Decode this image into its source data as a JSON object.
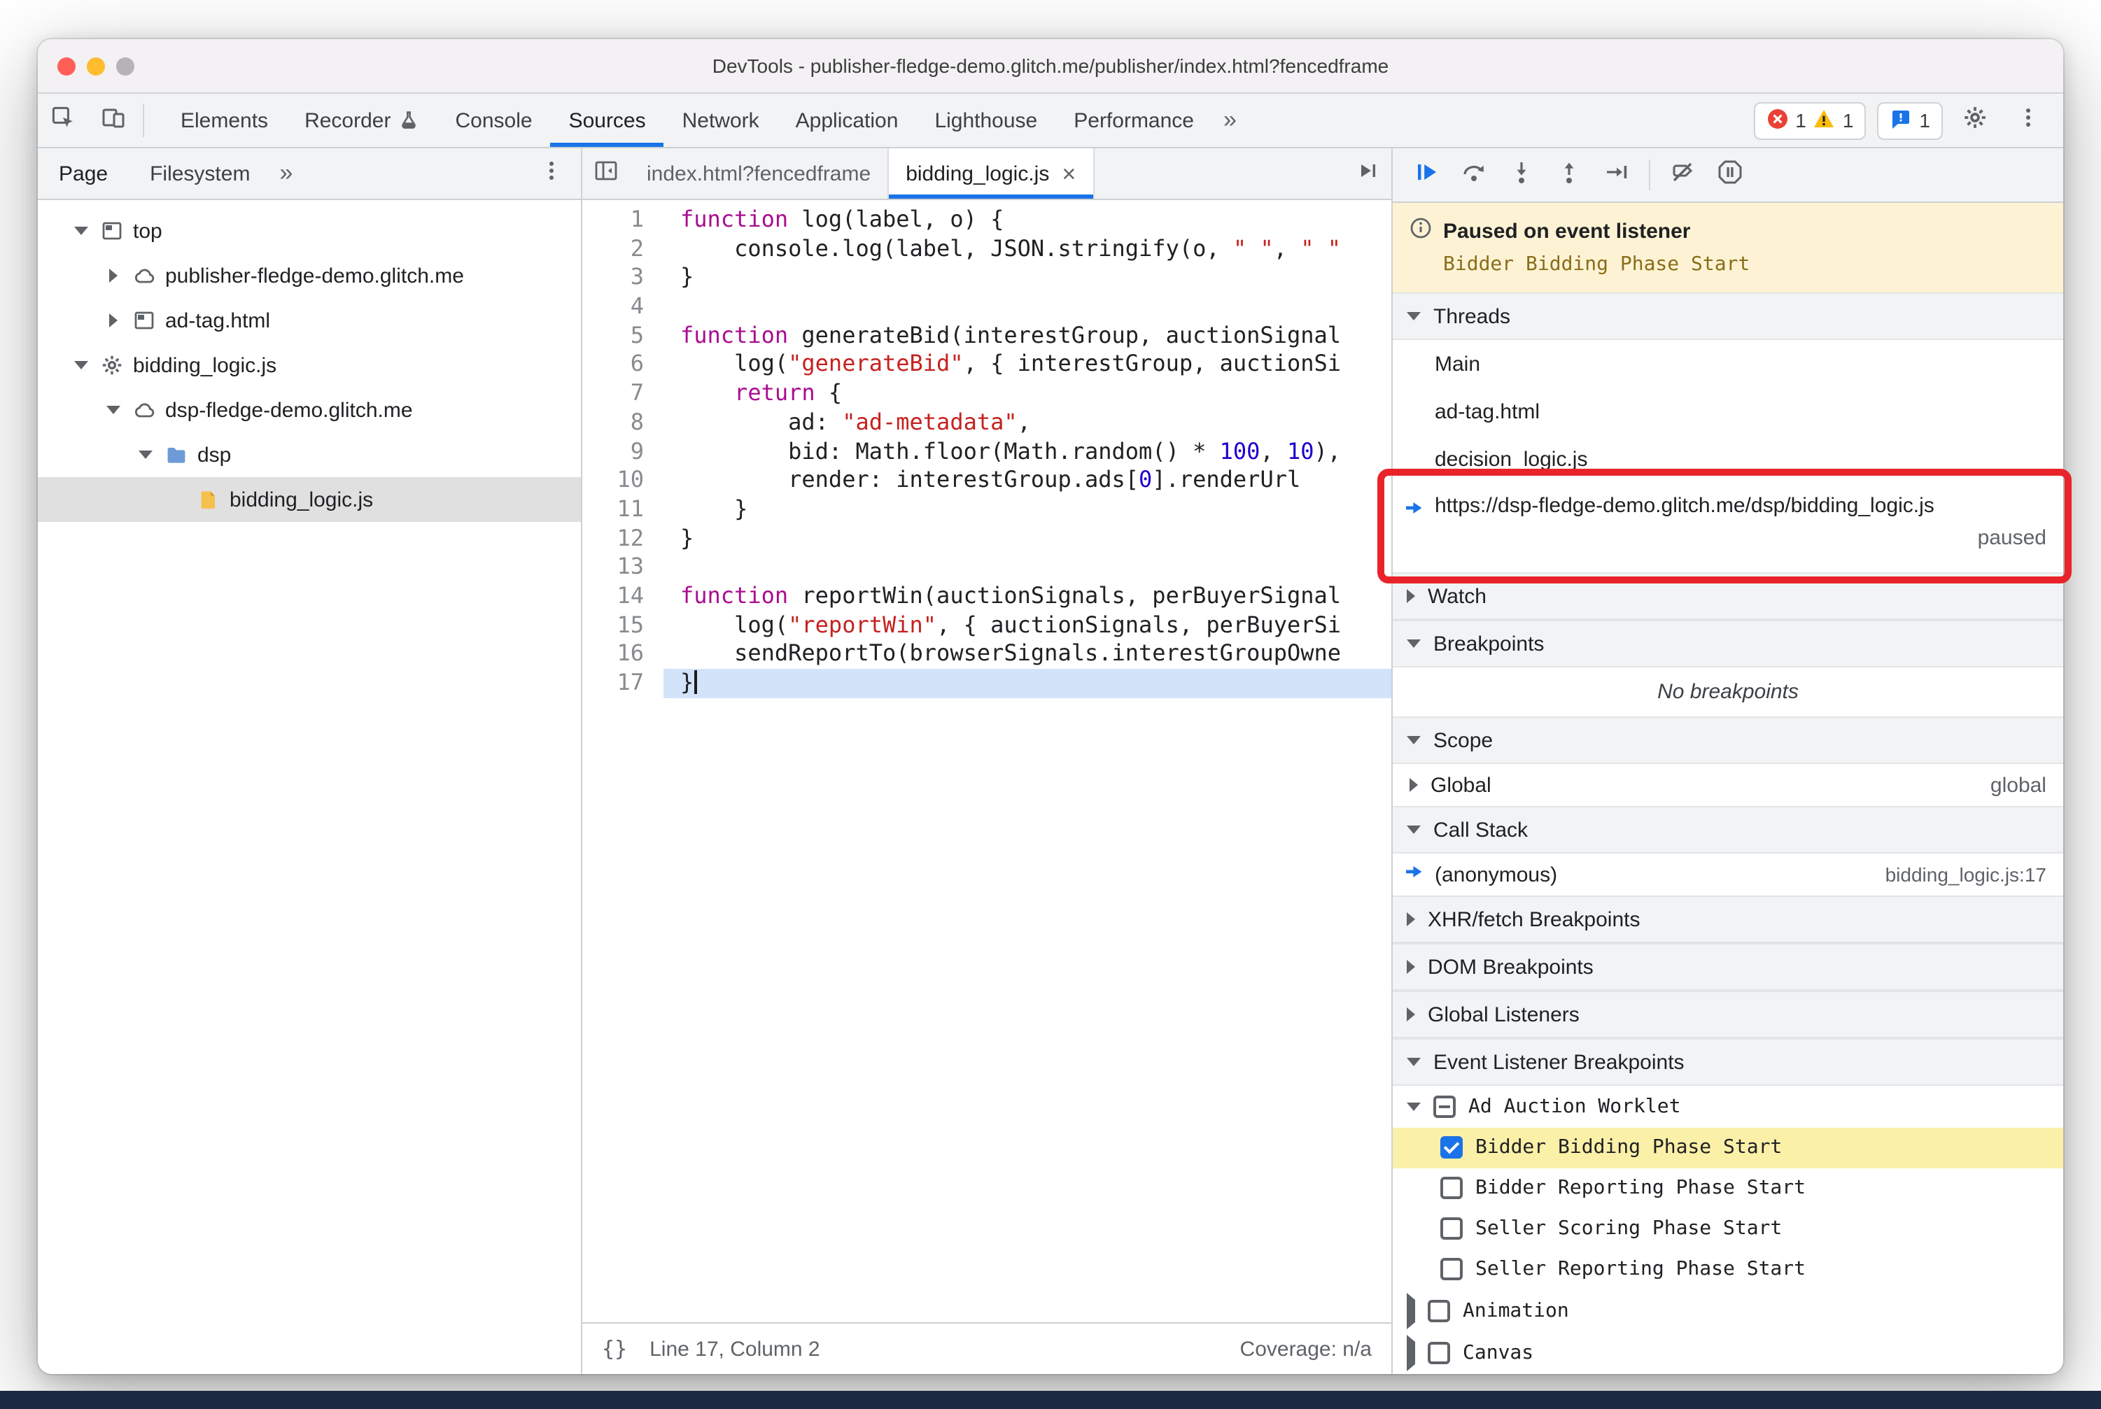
{
  "window": {
    "title": "DevTools - publisher-fledge-demo.glitch.me/publisher/index.html?fencedframe"
  },
  "main_toolbar": {
    "tabs": [
      {
        "label": "Elements"
      },
      {
        "label": "Recorder",
        "icon": "experiment"
      },
      {
        "label": "Console"
      },
      {
        "label": "Sources",
        "active": true
      },
      {
        "label": "Network"
      },
      {
        "label": "Application"
      },
      {
        "label": "Lighthouse"
      },
      {
        "label": "Performance"
      }
    ],
    "more_tabs_glyph": "»",
    "error_count": "1",
    "warning_count": "1",
    "issues_count": "1"
  },
  "navigator": {
    "tabs": [
      {
        "label": "Page",
        "active": true
      },
      {
        "label": "Filesystem"
      }
    ],
    "more_glyph": "»",
    "tree": [
      {
        "label": "top",
        "icon": "frame",
        "expand": "open",
        "indent": 0
      },
      {
        "label": "publisher-fledge-demo.glitch.me",
        "icon": "cloud",
        "expand": "closed",
        "indent": 1
      },
      {
        "label": "ad-tag.html",
        "icon": "frame",
        "expand": "closed",
        "indent": 1
      },
      {
        "label": "bidding_logic.js",
        "icon": "gear",
        "expand": "open",
        "indent": 0
      },
      {
        "label": "dsp-fledge-demo.glitch.me",
        "icon": "cloud",
        "expand": "open",
        "indent": 1
      },
      {
        "label": "dsp",
        "icon": "folder",
        "expand": "open",
        "indent": 2
      },
      {
        "label": "bidding_logic.js",
        "icon": "file",
        "expand": "none",
        "indent": 3,
        "selected": true
      }
    ]
  },
  "editor": {
    "tabs": [
      {
        "label": "index.html?fencedframe"
      },
      {
        "label": "bidding_logic.js",
        "active": true,
        "closable": true
      }
    ],
    "exec_line": 17,
    "code": [
      [
        [
          "k",
          "function"
        ],
        [
          "p",
          " log(label, o) {"
        ]
      ],
      [
        [
          "p",
          "    console.log(label, JSON.stringify(o, "
        ],
        [
          "s",
          "\" \""
        ],
        [
          "p",
          ", "
        ],
        [
          "s",
          "\" \""
        ]
      ],
      [
        [
          "p",
          "}"
        ]
      ],
      [],
      [
        [
          "k",
          "function"
        ],
        [
          "p",
          " generateBid(interestGroup, auctionSignal"
        ]
      ],
      [
        [
          "p",
          "    log("
        ],
        [
          "s",
          "\"generateBid\""
        ],
        [
          "p",
          ", { interestGroup, auctionSi"
        ]
      ],
      [
        [
          "p",
          "    "
        ],
        [
          "k",
          "return"
        ],
        [
          "p",
          " {"
        ]
      ],
      [
        [
          "p",
          "        ad: "
        ],
        [
          "s",
          "\"ad-metadata\""
        ],
        [
          "p",
          ","
        ]
      ],
      [
        [
          "p",
          "        bid: Math.floor(Math.random() * "
        ],
        [
          "n",
          "100"
        ],
        [
          "p",
          ", "
        ],
        [
          "n",
          "10"
        ],
        [
          "p",
          "),"
        ]
      ],
      [
        [
          "p",
          "        render: interestGroup.ads["
        ],
        [
          "n",
          "0"
        ],
        [
          "p",
          "].renderUrl"
        ]
      ],
      [
        [
          "p",
          "    }"
        ]
      ],
      [
        [
          "p",
          "}"
        ]
      ],
      [],
      [
        [
          "k",
          "function"
        ],
        [
          "p",
          " reportWin(auctionSignals, perBuyerSignal"
        ]
      ],
      [
        [
          "p",
          "    log("
        ],
        [
          "s",
          "\"reportWin\""
        ],
        [
          "p",
          ", { auctionSignals, perBuyerSi"
        ]
      ],
      [
        [
          "p",
          "    sendReportTo(browserSignals.interestGroupOwne"
        ]
      ],
      [
        [
          "p",
          "}"
        ]
      ]
    ],
    "status": {
      "format_glyph": "{}",
      "line_col": "Line 17, Column 2",
      "coverage": "Coverage: n/a"
    }
  },
  "debugger": {
    "banner": {
      "title": "Paused on event listener",
      "detail": "Bidder Bidding Phase Start"
    },
    "sections": {
      "threads": "Threads",
      "watch": "Watch",
      "breakpoints": "Breakpoints",
      "scope": "Scope",
      "call_stack": "Call Stack",
      "xhr": "XHR/fetch Breakpoints",
      "dom": "DOM Breakpoints",
      "global_listeners": "Global Listeners",
      "elb": "Event Listener Breakpoints"
    },
    "threads": [
      {
        "label": "Main"
      },
      {
        "label": "ad-tag.html"
      },
      {
        "label": "decision_logic.js"
      },
      {
        "label": "https://dsp-fledge-demo.glitch.me/dsp/bidding_logic.js",
        "active": true,
        "status": "paused"
      }
    ],
    "breakpoints_empty": "No breakpoints",
    "scope_rows": [
      {
        "label": "Global",
        "value": "global"
      }
    ],
    "call_stack_rows": [
      {
        "label": "(anonymous)",
        "location": "bidding_logic.js:17",
        "active": true
      }
    ],
    "elb": {
      "group": {
        "label": "Ad Auction Worklet",
        "checkbox": "indeterminate",
        "expand": "open"
      },
      "events": [
        {
          "label": "Bidder Bidding Phase Start",
          "checked": true,
          "highlighted": true
        },
        {
          "label": "Bidder Reporting Phase Start",
          "checked": false
        },
        {
          "label": "Seller Scoring Phase Start",
          "checked": false
        },
        {
          "label": "Seller Reporting Phase Start",
          "checked": false
        }
      ],
      "more_groups": [
        {
          "label": "Animation",
          "expand": "closed",
          "checked": false
        },
        {
          "label": "Canvas",
          "expand": "closed",
          "checked": false
        }
      ]
    }
  },
  "colors": {
    "accent_blue": "#1a73e8",
    "error_red": "#e94235",
    "warning_yellow": "#fbbc04",
    "annotation_red": "#e8242a",
    "paused_banner_bg": "#fdf3d4",
    "exec_line_bg": "#d2e3fa",
    "breakpoint_hit_bg": "#fbf0a7"
  }
}
